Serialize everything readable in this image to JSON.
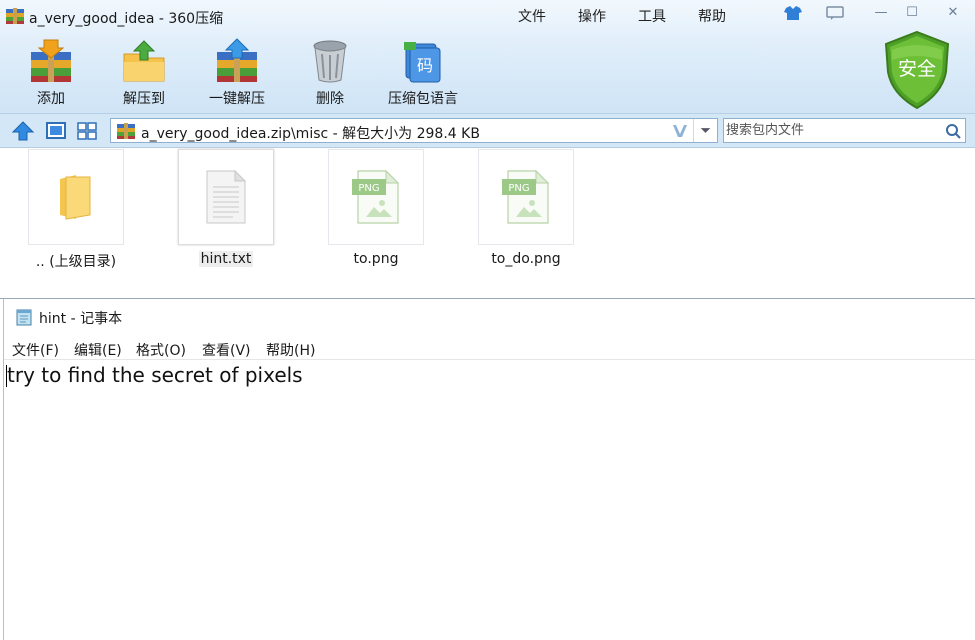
{
  "zip": {
    "title": "a_very_good_idea - 360压缩",
    "menu": [
      "文件",
      "操作",
      "工具",
      "帮助"
    ],
    "controls": {
      "skin": "skin-icon",
      "feedback": "feedback-icon",
      "min": "—",
      "max": "☐",
      "close": "✕"
    },
    "toolbar": [
      {
        "label": "添加",
        "icon": "add-archive-icon"
      },
      {
        "label": "解压到",
        "icon": "extract-to-icon"
      },
      {
        "label": "一键解压",
        "icon": "one-click-extract-icon"
      },
      {
        "label": "删除",
        "icon": "delete-icon"
      },
      {
        "label": "压缩包语言",
        "icon": "archive-language-icon"
      }
    ],
    "shield_label": "安全",
    "address": "a_very_good_idea.zip\\misc - 解包大小为 298.4 KB",
    "search_placeholder": "搜索包内文件",
    "files": [
      {
        "name": ".. (上级目录)",
        "type": "folder"
      },
      {
        "name": "hint.txt",
        "type": "txt"
      },
      {
        "name": "to.png",
        "type": "png"
      },
      {
        "name": "to_do.png",
        "type": "png"
      }
    ],
    "png_tag": "PNG"
  },
  "notepad": {
    "title": "hint - 记事本",
    "menu": [
      "文件(F)",
      "编辑(E)",
      "格式(O)",
      "查看(V)",
      "帮助(H)"
    ],
    "content": "try to find the secret of pixels"
  }
}
